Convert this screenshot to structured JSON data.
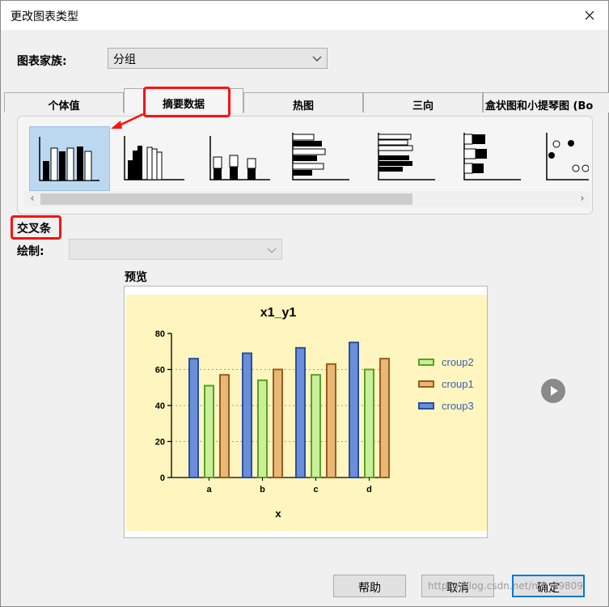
{
  "window": {
    "title": "更改图表类型"
  },
  "family": {
    "label": "图表家族:",
    "selected": "分组"
  },
  "tabs": [
    {
      "label": "个体值",
      "active": false
    },
    {
      "label": "摘要数据",
      "active": true
    },
    {
      "label": "热图",
      "active": false
    },
    {
      "label": "三向",
      "active": false
    },
    {
      "label": "盒状图和小提琴图 (Bo",
      "active": false
    }
  ],
  "thumbnails": [
    {
      "name": "bars-side-by-side",
      "selected": true
    },
    {
      "name": "bars-grouped-mixed",
      "selected": false
    },
    {
      "name": "bars-stacked",
      "selected": false
    },
    {
      "name": "horizontal-bars",
      "selected": false
    },
    {
      "name": "horizontal-bars-grouped",
      "selected": false
    },
    {
      "name": "horizontal-bars-stacked",
      "selected": false
    },
    {
      "name": "dot-plot",
      "selected": false
    }
  ],
  "section": {
    "title": "交叉条"
  },
  "plot": {
    "label": "绘制:",
    "value": ""
  },
  "preview": {
    "label": "预览"
  },
  "chart_data": {
    "type": "bar",
    "title": "x1_y1",
    "xlabel": "x",
    "ylabel": "",
    "categories": [
      "a",
      "b",
      "c",
      "d"
    ],
    "ylim": [
      0,
      80
    ],
    "yticks": [
      0,
      20,
      40,
      60,
      80
    ],
    "grid": "horizontal dotted at 20, 40, 60",
    "legend_position": "right",
    "series": [
      {
        "name": "croup3",
        "values": [
          66,
          69,
          72,
          75
        ],
        "fill": "#6a8fd8",
        "stroke": "#2a4fa0"
      },
      {
        "name": "croup2",
        "values": [
          51,
          54,
          57,
          60
        ],
        "fill": "#c8f09a",
        "stroke": "#5aa02a"
      },
      {
        "name": "croup1",
        "values": [
          57,
          60,
          63,
          66
        ],
        "fill": "#e8b878",
        "stroke": "#a05a1a"
      }
    ],
    "legend_order": [
      "croup2",
      "croup1",
      "croup3"
    ],
    "background": "#fff6bf"
  },
  "buttons": {
    "help": "帮助",
    "cancel": "取消",
    "ok": "确定"
  },
  "watermark": "https://blog.csdn.net/m0_49809"
}
